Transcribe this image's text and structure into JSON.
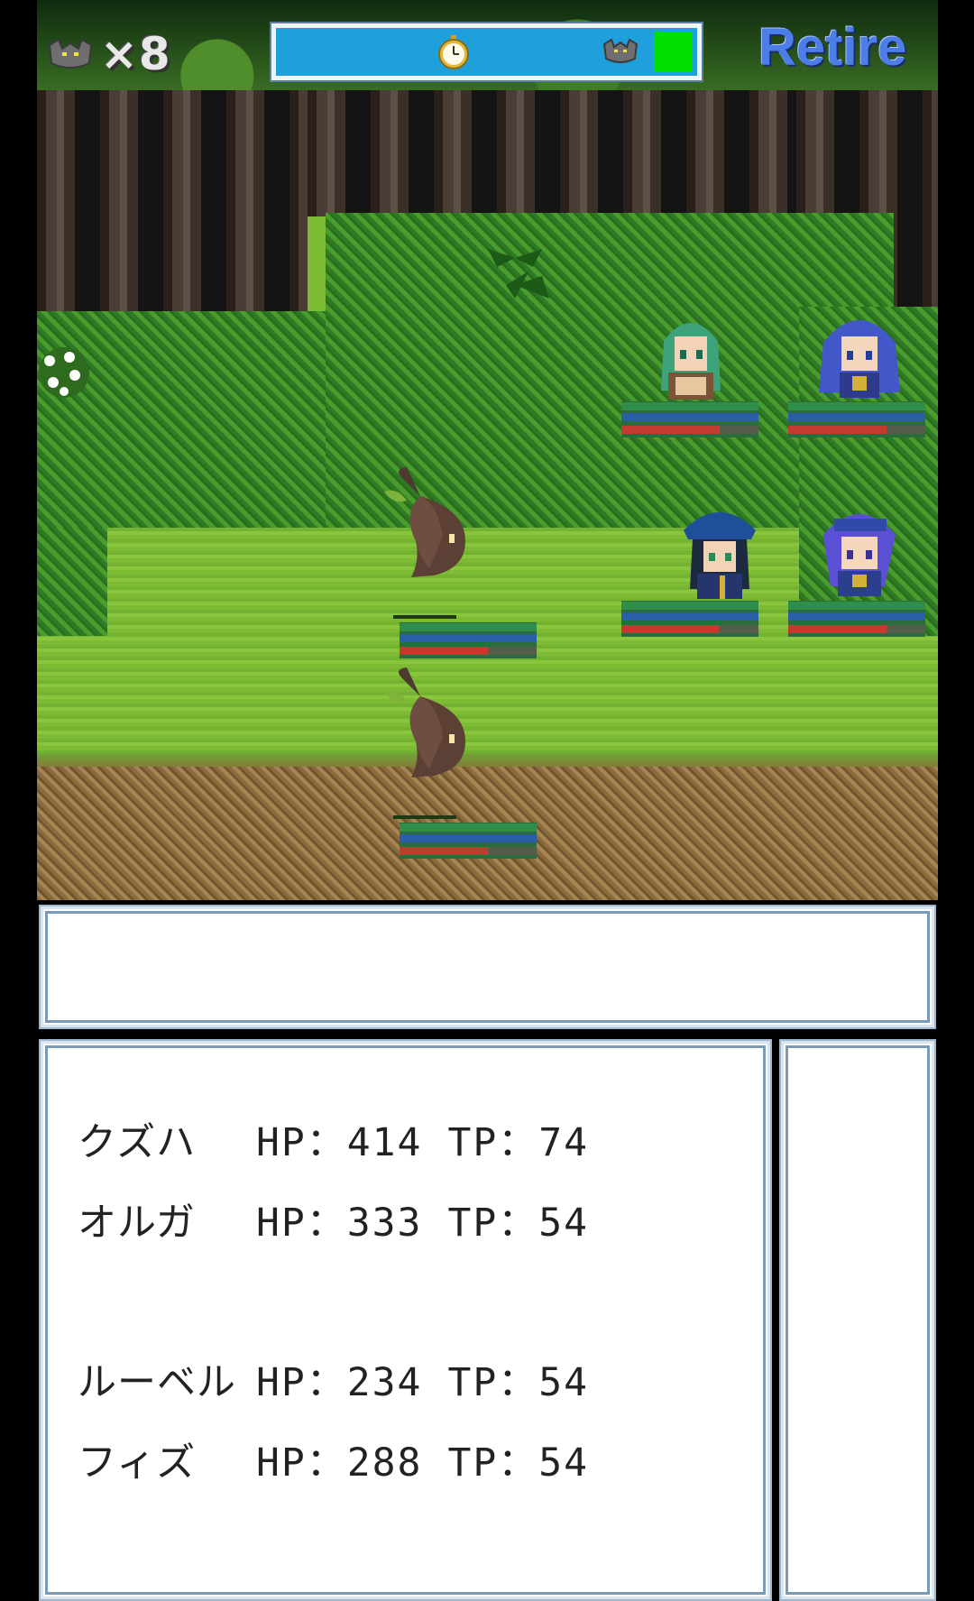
{
  "hud": {
    "enemy_count": "×8",
    "timer_icon": "pocket-watch-icon",
    "enemy_icon": "bat-icon",
    "retire_label": "Retire",
    "timer_fill_color": "#1fa0dd",
    "timer_end_color": "#00e000"
  },
  "message": {
    "text": ""
  },
  "party": [
    {
      "name": "クズハ",
      "hp_label": "HP：414",
      "tp_label": "TP：74"
    },
    {
      "name": "オルガ",
      "hp_label": "HP：333",
      "tp_label": "TP：54"
    },
    {
      "name": "ルーベル",
      "hp_label": "HP：234",
      "tp_label": "TP：54"
    },
    {
      "name": "フィズ",
      "hp_label": "HP：288",
      "tp_label": "TP：54"
    }
  ],
  "enemies": [
    {
      "sprite": "sprout-creature-icon",
      "hp_fraction": 0.65
    },
    {
      "sprite": "sprout-creature-icon",
      "hp_fraction": 0.65
    }
  ],
  "allies_on_field": [
    {
      "sprite": "green-haired-girl-sprite",
      "hp_fraction": 0.72
    },
    {
      "sprite": "blue-haired-girl-sprite",
      "hp_fraction": 0.72
    },
    {
      "sprite": "dark-haired-hat-girl-sprite",
      "hp_fraction": 0.72
    },
    {
      "sprite": "purple-haired-girl-sprite",
      "hp_fraction": 0.72
    }
  ],
  "colors": {
    "window_border": "#7a9bb8",
    "retire_text": "#4d7ee8",
    "hp_red": "#c23b2e",
    "bar_green": "#2f8f4a",
    "bar_blue": "#2a5fa8"
  }
}
